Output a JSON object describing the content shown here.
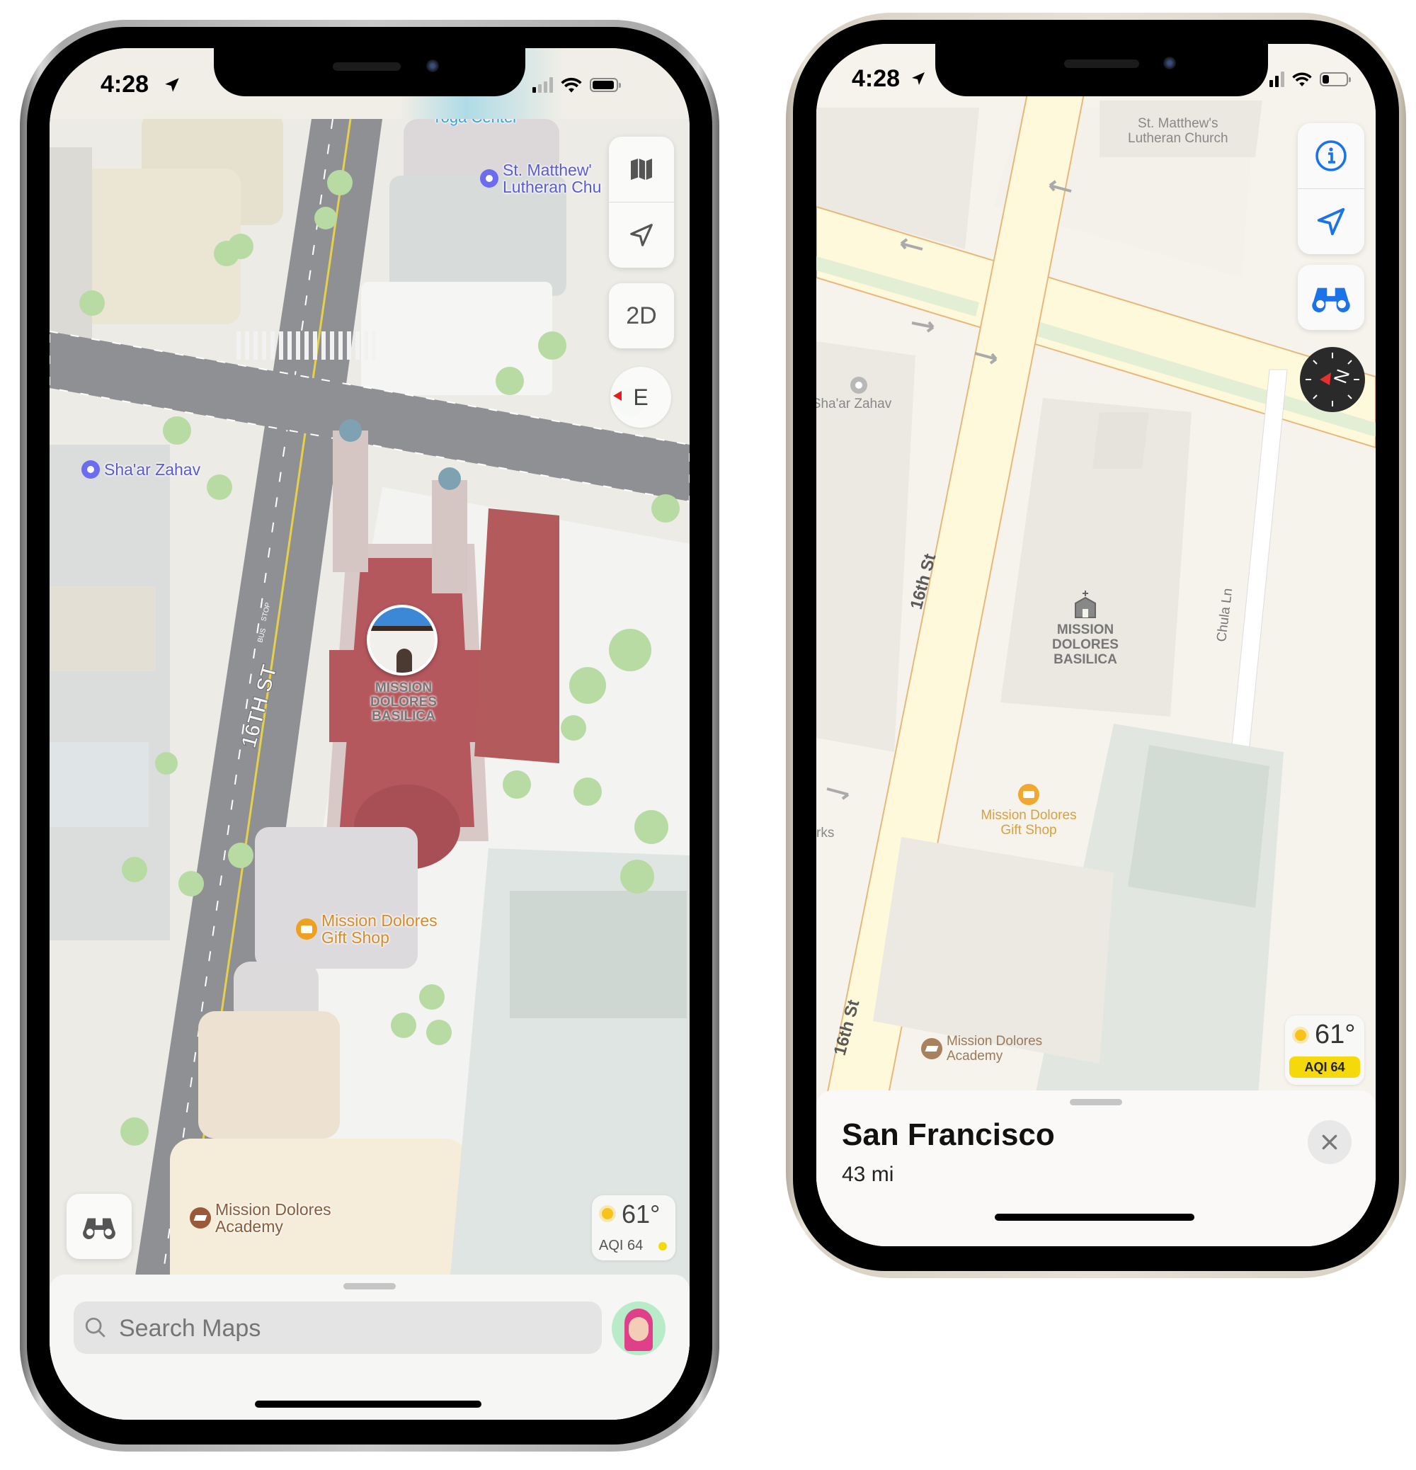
{
  "left_phone": {
    "status_bar": {
      "time": "4:28",
      "location_icon": "location-arrow-icon",
      "signal_bars_active": 1,
      "signal_bars_total": 4,
      "battery_level": 0.85
    },
    "map": {
      "poi_labels": [
        {
          "name": "Yoga Center",
          "category": "partial-label"
        },
        {
          "name": "St. Matthew's Lutheran Church",
          "display": [
            "St. Matthew'",
            "Lutheran Chu"
          ],
          "icon": "place-dot-icon",
          "color": "#5a5ad8"
        },
        {
          "name": "Sha'ar Zahav",
          "icon": "place-dot-icon",
          "color": "#5a5ad8"
        },
        {
          "name": "Mission Dolores Basilica",
          "display": [
            "MISSION",
            "DOLORES",
            "BASILICA"
          ],
          "icon": "landmark-photo-icon"
        },
        {
          "name": "Mission Dolores Gift Shop",
          "display": [
            "Mission Dolores",
            "Gift Shop"
          ],
          "icon": "shopping-bag-icon",
          "color": "#d88a2a"
        },
        {
          "name": "Mission Dolores Academy",
          "display": [
            "Mission Dolores",
            "Academy"
          ],
          "icon": "graduation-cap-icon",
          "color": "#8a5a3a"
        }
      ],
      "street_labels": [
        "16TH ST",
        "16TH ST"
      ],
      "road_markings": [
        "STOP",
        "BUS"
      ]
    },
    "controls": {
      "map_mode_icon": "map-icon",
      "location_icon": "location-arrow-icon",
      "view_toggle_label": "2D",
      "compass_heading": "E",
      "lookaround_icon": "binoculars-icon"
    },
    "weather": {
      "temperature": "61°",
      "aqi_label": "AQI 64",
      "icon": "sun-icon",
      "aqi_color": "#f5d90a"
    },
    "sheet": {
      "search_placeholder": "Search Maps",
      "avatar": "memoji-avatar"
    }
  },
  "right_phone": {
    "status_bar": {
      "time": "4:28",
      "location_icon": "location-arrow-icon",
      "battery_level": 0.25
    },
    "map": {
      "poi_labels": [
        {
          "name": "St. Matthew's Lutheran Church",
          "display": [
            "St. Matthew's",
            "Lutheran Church"
          ]
        },
        {
          "name": "Sha'ar Zahav",
          "display": [
            "Sha'ar Zahav"
          ],
          "icon": "place-dot-icon"
        },
        {
          "name": "Mission Dolores Basilica",
          "display": [
            "MISSION",
            "DOLORES",
            "BASILICA"
          ],
          "icon": "church-icon"
        },
        {
          "name": "Mission Dolores Gift Shop",
          "display": [
            "Mission Dolores",
            "Gift Shop"
          ],
          "icon": "shopping-bag-icon",
          "color": "#e0a030"
        },
        {
          "name": "Mission Dolores Academy",
          "display": [
            "Mission Dolores",
            "Academy"
          ],
          "icon": "graduation-cap-icon",
          "color": "#a07a5a"
        },
        {
          "name": "rks",
          "display": [
            "rks"
          ]
        }
      ],
      "street_labels": [
        "16th St",
        "16th St",
        "Chula Ln"
      ]
    },
    "controls": {
      "info_icon": "info-icon",
      "location_icon": "location-arrow-icon",
      "lookaround_icon": "binoculars-icon",
      "compass_heading": "N"
    },
    "weather": {
      "temperature": "61°",
      "aqi_label": "AQI 64",
      "icon": "sun-icon",
      "aqi_color": "#f5d90a"
    },
    "sheet": {
      "title": "San Francisco",
      "subtitle": "43 mi",
      "close_icon": "close-icon"
    }
  },
  "colors": {
    "accent_blue": "#1a73e8",
    "poi_purple": "#5a5ad8",
    "road_gray": "#8e9094",
    "basilica_roof": "#b5585e"
  }
}
